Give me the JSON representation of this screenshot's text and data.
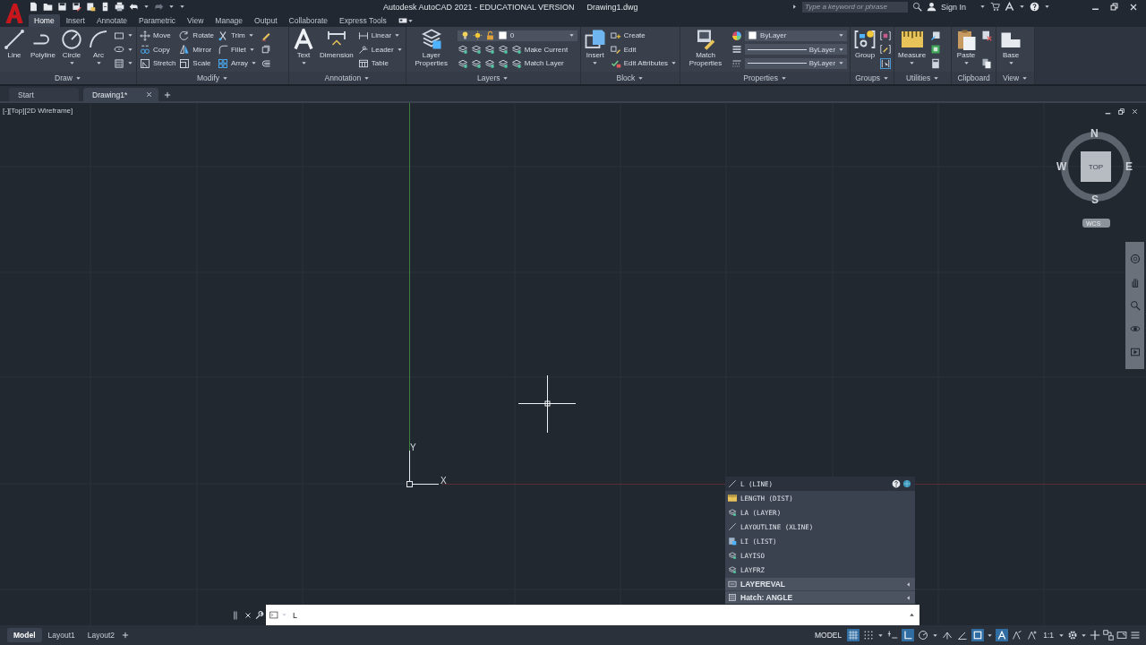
{
  "title_bar": {
    "title": "Autodesk AutoCAD 2021 - EDUCATIONAL VERSION",
    "file_name": "Drawing1.dwg",
    "search": {
      "placeholder": "Type a keyword or phrase"
    },
    "sign_in": "Sign In"
  },
  "ribbon_tabs": [
    {
      "label": "Home",
      "selected": true
    },
    {
      "label": "Insert",
      "selected": false
    },
    {
      "label": "Annotate",
      "selected": false
    },
    {
      "label": "Parametric",
      "selected": false
    },
    {
      "label": "View",
      "selected": false
    },
    {
      "label": "Manage",
      "selected": false
    },
    {
      "label": "Output",
      "selected": false
    },
    {
      "label": "Collaborate",
      "selected": false
    },
    {
      "label": "Express Tools",
      "selected": false
    }
  ],
  "ribbon_panels": [
    {
      "title": "Draw",
      "menu": true,
      "tools": [
        {
          "kind": "large",
          "label": "Line",
          "dropdown": false
        },
        {
          "kind": "large",
          "label": "Polyline",
          "dropdown": false
        },
        {
          "kind": "large",
          "label": "Circle",
          "dropdown": true
        },
        {
          "kind": "large",
          "label": "Arc",
          "dropdown": true
        },
        {
          "kind": "icon",
          "dropdown": true
        },
        {
          "kind": "icon",
          "dropdown": true
        },
        {
          "kind": "icon",
          "dropdown": true
        }
      ]
    },
    {
      "title": "Modify",
      "menu": true,
      "tools": [
        {
          "kind": "small",
          "label": "Move",
          "dropdown": false
        },
        {
          "kind": "small",
          "label": "Copy",
          "dropdown": false
        },
        {
          "kind": "small",
          "label": "Stretch",
          "dropdown": false
        },
        {
          "kind": "small",
          "label": "Rotate",
          "dropdown": false
        },
        {
          "kind": "small",
          "label": "Mirror",
          "dropdown": false
        },
        {
          "kind": "small",
          "label": "Scale",
          "dropdown": false
        },
        {
          "kind": "small",
          "label": "Trim",
          "dropdown": true
        },
        {
          "kind": "small",
          "label": "Fillet",
          "dropdown": true
        },
        {
          "kind": "small",
          "label": "Array",
          "dropdown": true
        },
        {
          "kind": "icon",
          "dropdown": false
        },
        {
          "kind": "icon",
          "dropdown": false
        },
        {
          "kind": "icon",
          "dropdown": false
        }
      ]
    },
    {
      "title": "Annotation",
      "menu": true,
      "tools": [
        {
          "kind": "large",
          "label": "Text",
          "dropdown": true
        },
        {
          "kind": "large",
          "label": "Dimension",
          "dropdown": false
        },
        {
          "kind": "small",
          "label": "Linear",
          "dropdown": true
        },
        {
          "kind": "small",
          "label": "Leader",
          "dropdown": true
        },
        {
          "kind": "small",
          "label": "Table",
          "dropdown": false
        }
      ]
    },
    {
      "title": "Layers",
      "menu": true,
      "tools": [
        {
          "kind": "large",
          "label": "Layer Properties",
          "dropdown": false
        },
        {
          "kind": "field",
          "value": "0",
          "dropdown": true
        },
        {
          "kind": "small",
          "label": "Make Current",
          "dropdown": false
        },
        {
          "kind": "small",
          "label": "Match Layer",
          "dropdown": false
        }
      ]
    },
    {
      "title": "Block",
      "menu": true,
      "tools": [
        {
          "kind": "large",
          "label": "Insert",
          "dropdown": true
        },
        {
          "kind": "small",
          "label": "Create",
          "dropdown": false
        },
        {
          "kind": "small",
          "label": "Edit",
          "dropdown": false
        },
        {
          "kind": "small",
          "label": "Edit Attributes",
          "dropdown": true
        }
      ]
    },
    {
      "title": "Properties",
      "menu": true,
      "tools": [
        {
          "kind": "large",
          "label": "Match Properties",
          "dropdown": false
        },
        {
          "kind": "field",
          "value": "ByLayer",
          "dropdown": true
        },
        {
          "kind": "field",
          "value": "ByLayer",
          "dropdown": true
        },
        {
          "kind": "field",
          "value": "ByLayer",
          "dropdown": true
        }
      ]
    },
    {
      "title": "Groups",
      "menu": true,
      "tools": [
        {
          "kind": "large",
          "label": "Group",
          "dropdown": false
        },
        {
          "kind": "icon",
          "dropdown": false
        },
        {
          "kind": "icon",
          "dropdown": false
        },
        {
          "kind": "icon",
          "dropdown": false
        }
      ]
    },
    {
      "title": "Utilities",
      "menu": true,
      "tools": [
        {
          "kind": "large",
          "label": "Measure",
          "dropdown": true
        },
        {
          "kind": "icon",
          "dropdown": false
        },
        {
          "kind": "icon",
          "dropdown": false
        },
        {
          "kind": "icon",
          "dropdown": false
        }
      ]
    },
    {
      "title": "Clipboard",
      "menu": false,
      "tools": [
        {
          "kind": "large",
          "label": "Paste",
          "dropdown": true
        },
        {
          "kind": "icon",
          "dropdown": false
        },
        {
          "kind": "icon",
          "dropdown": false
        }
      ]
    },
    {
      "title": "View",
      "menu": true,
      "tools": [
        {
          "kind": "large",
          "label": "Base",
          "dropdown": true
        }
      ]
    }
  ],
  "file_tabs": [
    {
      "label": "Start",
      "selected": false,
      "closable": false
    },
    {
      "label": "Drawing1*",
      "selected": true,
      "closable": true
    }
  ],
  "viewport": {
    "label": "[-][Top][2D Wireframe]",
    "viewcube": {
      "north": "N",
      "east": "E",
      "south": "S",
      "west": "W",
      "face": "TOP",
      "ucs_menu": "WCS"
    },
    "ucs_icon": {
      "y_label": "Y",
      "x_label": "X"
    }
  },
  "autocomplete": [
    {
      "label": "L (LINE)",
      "kind": "command",
      "selected": true
    },
    {
      "label": "LENGTH (DIST)",
      "kind": "command",
      "selected": false
    },
    {
      "label": "LA (LAYER)",
      "kind": "command",
      "selected": false
    },
    {
      "label": "LAYOUTLINE (XLINE)",
      "kind": "command",
      "selected": false
    },
    {
      "label": "LI (LIST)",
      "kind": "command",
      "selected": false
    },
    {
      "label": "LAYISO",
      "kind": "command",
      "selected": false
    },
    {
      "label": "LAYFRZ",
      "kind": "command",
      "selected": false
    },
    {
      "label": "LAYEREVAL",
      "kind": "category",
      "selected": false
    },
    {
      "label": "Hatch: ANGLE",
      "kind": "category",
      "selected": false
    }
  ],
  "command_line": {
    "value": "L"
  },
  "layout_tabs": [
    {
      "label": "Model",
      "selected": true
    },
    {
      "label": "Layout1",
      "selected": false
    },
    {
      "label": "Layout2",
      "selected": false
    }
  ],
  "status_bar": {
    "space": "MODEL",
    "scale": "1:1",
    "toggles": [
      {
        "on": true
      },
      {
        "on": false
      },
      {
        "on": false
      },
      {
        "on": true
      },
      {
        "on": false
      },
      {
        "on": false
      },
      {
        "on": false
      },
      {
        "on": true
      },
      {
        "on": true
      },
      {
        "on": false
      },
      {
        "on": false
      }
    ]
  }
}
